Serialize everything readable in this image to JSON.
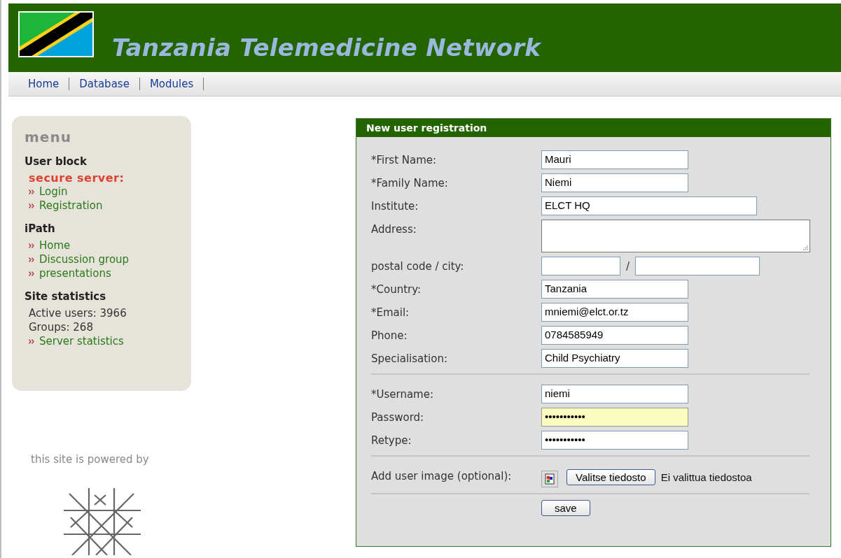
{
  "header": {
    "title": "Tanzania Telemedicine Network"
  },
  "nav": [
    "Home",
    "Database",
    "Modules"
  ],
  "sidebar": {
    "title": "menu",
    "sections": [
      {
        "heading": "User block",
        "items": [
          {
            "kind": "alert",
            "label": "secure server:"
          },
          {
            "kind": "link",
            "label": "Login"
          },
          {
            "kind": "link",
            "label": "Registration"
          }
        ]
      },
      {
        "heading": "iPath",
        "items": [
          {
            "kind": "link",
            "label": "Home"
          },
          {
            "kind": "link",
            "label": "Discussion group"
          },
          {
            "kind": "link",
            "label": "presentations"
          }
        ]
      },
      {
        "heading": "Site statistics",
        "items": [
          {
            "kind": "stat",
            "label": "Active users: 3966"
          },
          {
            "kind": "stat",
            "label": "Groups: 268"
          },
          {
            "kind": "link",
            "label": "Server statistics"
          }
        ]
      }
    ]
  },
  "powered_by": "this site is powered by",
  "form": {
    "title": "New user registration",
    "rows": [
      {
        "kind": "text",
        "label": "*First Name:",
        "value": "Mauri",
        "highlighted": false
      },
      {
        "kind": "text",
        "label": "*Family Name:",
        "value": "Niemi",
        "highlighted": false
      },
      {
        "kind": "wide-text",
        "label": "Institute:",
        "value": "ELCT HQ",
        "highlighted": false
      },
      {
        "kind": "textarea",
        "label": "Address:"
      },
      {
        "kind": "pair",
        "label": "postal code / city:",
        "separator": "/"
      },
      {
        "kind": "text",
        "label": "*Country:",
        "value": "Tanzania",
        "highlighted": false
      },
      {
        "kind": "text",
        "label": "*Email:",
        "value": "mniemi@elct.or.tz",
        "highlighted": false
      },
      {
        "kind": "text",
        "label": "Phone:",
        "value": "0784585949",
        "highlighted": false
      },
      {
        "kind": "text",
        "label": "Specialisation:",
        "value": "Child Psychiatry",
        "highlighted": false
      },
      {
        "kind": "rule"
      },
      {
        "kind": "text",
        "label": "*Username:",
        "value": "niemi",
        "highlighted": false
      },
      {
        "kind": "text",
        "label": "Password:",
        "value": "•••••••••••",
        "highlighted": true
      },
      {
        "kind": "text",
        "label": "Retype:",
        "value": "•••••••••••",
        "highlighted": false
      },
      {
        "kind": "rule"
      },
      {
        "kind": "file",
        "label": "Add user image (optional):",
        "button": "Valitse tiedosto",
        "status": "Ei valittua tiedostoa"
      },
      {
        "kind": "rule"
      },
      {
        "kind": "submit",
        "button": "save"
      }
    ]
  }
}
